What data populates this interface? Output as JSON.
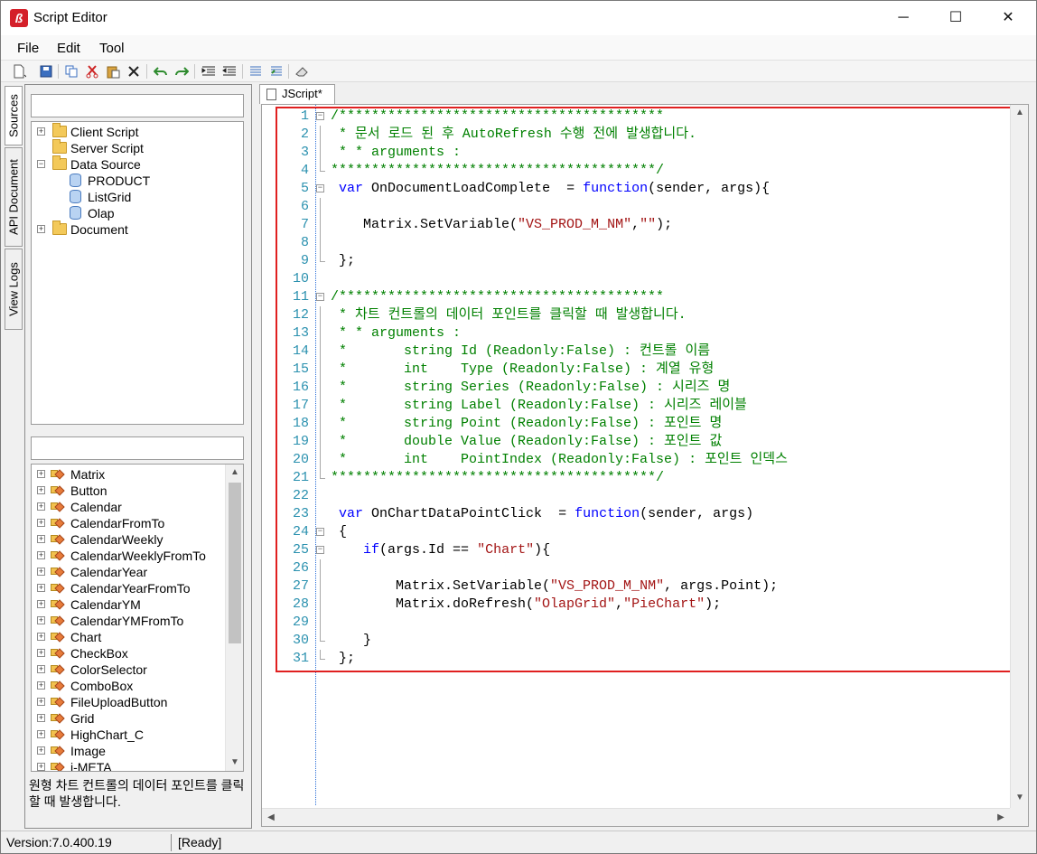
{
  "window": {
    "title": "Script Editor",
    "controls": {
      "minimize": "─",
      "maximize": "☐",
      "close": "✕"
    }
  },
  "menu": [
    "File",
    "Edit",
    "Tool"
  ],
  "toolbar_icons": [
    "new-file-icon",
    "save-icon",
    "copy-icon",
    "cut-icon",
    "paste-icon",
    "delete-icon",
    "undo-icon",
    "redo-icon",
    "indent-icon",
    "outdent-icon",
    "comment-icon",
    "uncomment-icon",
    "eraser-icon"
  ],
  "side_tabs": [
    "Sources",
    "API Document",
    "View Logs"
  ],
  "sources_filter": {
    "value": ""
  },
  "source_tree": [
    {
      "label": "Client Script",
      "type": "folder",
      "expander": "+",
      "level": 0
    },
    {
      "label": "Server Script",
      "type": "folder",
      "expander": "",
      "level": 0
    },
    {
      "label": "Data Source",
      "type": "folder",
      "expander": "−",
      "level": 0
    },
    {
      "label": "PRODUCT",
      "type": "datasource",
      "expander": "",
      "level": 1
    },
    {
      "label": "ListGrid",
      "type": "datasource",
      "expander": "",
      "level": 1
    },
    {
      "label": "Olap",
      "type": "datasource",
      "expander": "",
      "level": 1
    },
    {
      "label": "Document",
      "type": "folder",
      "expander": "+",
      "level": 0
    }
  ],
  "controls_filter": {
    "value": ""
  },
  "control_list": [
    "Matrix",
    "Button",
    "Calendar",
    "CalendarFromTo",
    "CalendarWeekly",
    "CalendarWeeklyFromTo",
    "CalendarYear",
    "CalendarYearFromTo",
    "CalendarYM",
    "CalendarYMFromTo",
    "Chart",
    "CheckBox",
    "ColorSelector",
    "ComboBox",
    "FileUploadButton",
    "Grid",
    "HighChart_C",
    "Image",
    "i-META"
  ],
  "description": "원형 차트 컨트롤의 데이터 포인트를 클릭할 때 발생합니다.",
  "editor": {
    "tab_label": "JScript*",
    "lines": [
      {
        "n": "1",
        "fold": "box",
        "tokens": [
          [
            "c",
            "/****************************************"
          ]
        ]
      },
      {
        "n": "2",
        "fold": "line",
        "tokens": [
          [
            "c",
            " * 문서 로드 된 후 AutoRefresh 수행 전에 발생합니다."
          ]
        ]
      },
      {
        "n": "3",
        "fold": "line",
        "tokens": [
          [
            "c",
            " * * arguments :"
          ]
        ]
      },
      {
        "n": "4",
        "fold": "end",
        "tokens": [
          [
            "c",
            "****************************************/"
          ]
        ]
      },
      {
        "n": "5",
        "fold": "box",
        "tokens": [
          [
            "p",
            " "
          ],
          [
            "k",
            "var"
          ],
          [
            "p",
            " OnDocumentLoadComplete  = "
          ],
          [
            "k",
            "function"
          ],
          [
            "p",
            "(sender, args){"
          ]
        ]
      },
      {
        "n": "6",
        "fold": "line",
        "tokens": []
      },
      {
        "n": "7",
        "fold": "line",
        "tokens": [
          [
            "p",
            "    Matrix.SetVariable("
          ],
          [
            "s",
            "\"VS_PROD_M_NM\""
          ],
          [
            "p",
            ","
          ],
          [
            "s",
            "\"\""
          ],
          [
            "p",
            ");"
          ]
        ]
      },
      {
        "n": "8",
        "fold": "line",
        "tokens": []
      },
      {
        "n": "9",
        "fold": "end",
        "tokens": [
          [
            "p",
            " };"
          ]
        ]
      },
      {
        "n": "10",
        "fold": "",
        "tokens": []
      },
      {
        "n": "11",
        "fold": "box",
        "tokens": [
          [
            "c",
            "/****************************************"
          ]
        ]
      },
      {
        "n": "12",
        "fold": "line",
        "tokens": [
          [
            "c",
            " * 차트 컨트롤의 데이터 포인트를 클릭할 때 발생합니다."
          ]
        ]
      },
      {
        "n": "13",
        "fold": "line",
        "tokens": [
          [
            "c",
            " * * arguments :"
          ]
        ]
      },
      {
        "n": "14",
        "fold": "line",
        "tokens": [
          [
            "c",
            " *       string Id (Readonly:False) : 컨트롤 이름"
          ]
        ]
      },
      {
        "n": "15",
        "fold": "line",
        "tokens": [
          [
            "c",
            " *       int    Type (Readonly:False) : 계열 유형"
          ]
        ]
      },
      {
        "n": "16",
        "fold": "line",
        "tokens": [
          [
            "c",
            " *       string Series (Readonly:False) : 시리즈 명"
          ]
        ]
      },
      {
        "n": "17",
        "fold": "line",
        "tokens": [
          [
            "c",
            " *       string Label (Readonly:False) : 시리즈 레이블"
          ]
        ]
      },
      {
        "n": "18",
        "fold": "line",
        "tokens": [
          [
            "c",
            " *       string Point (Readonly:False) : 포인트 명"
          ]
        ]
      },
      {
        "n": "19",
        "fold": "line",
        "tokens": [
          [
            "c",
            " *       double Value (Readonly:False) : 포인트 값"
          ]
        ]
      },
      {
        "n": "20",
        "fold": "line",
        "tokens": [
          [
            "c",
            " *       int    PointIndex (Readonly:False) : 포인트 인덱스"
          ]
        ]
      },
      {
        "n": "21",
        "fold": "end",
        "tokens": [
          [
            "c",
            "****************************************/"
          ]
        ]
      },
      {
        "n": "22",
        "fold": "",
        "tokens": []
      },
      {
        "n": "23",
        "fold": "",
        "tokens": [
          [
            "p",
            " "
          ],
          [
            "k",
            "var"
          ],
          [
            "p",
            " OnChartDataPointClick  = "
          ],
          [
            "k",
            "function"
          ],
          [
            "p",
            "(sender, args)"
          ]
        ]
      },
      {
        "n": "24",
        "fold": "box",
        "tokens": [
          [
            "p",
            " {"
          ]
        ]
      },
      {
        "n": "25",
        "fold": "box",
        "tokens": [
          [
            "p",
            "    "
          ],
          [
            "k",
            "if"
          ],
          [
            "p",
            "(args.Id == "
          ],
          [
            "s",
            "\"Chart\""
          ],
          [
            "p",
            "){"
          ]
        ]
      },
      {
        "n": "26",
        "fold": "line",
        "tokens": []
      },
      {
        "n": "27",
        "fold": "line",
        "tokens": [
          [
            "p",
            "        Matrix.SetVariable("
          ],
          [
            "s",
            "\"VS_PROD_M_NM\""
          ],
          [
            "p",
            ", args.Point);"
          ]
        ]
      },
      {
        "n": "28",
        "fold": "line",
        "tokens": [
          [
            "p",
            "        Matrix.doRefresh("
          ],
          [
            "s",
            "\"OlapGrid\""
          ],
          [
            "p",
            ","
          ],
          [
            "s",
            "\"PieChart\""
          ],
          [
            "p",
            ");"
          ]
        ]
      },
      {
        "n": "29",
        "fold": "line",
        "tokens": []
      },
      {
        "n": "30",
        "fold": "end",
        "tokens": [
          [
            "p",
            "    }"
          ]
        ]
      },
      {
        "n": "31",
        "fold": "end",
        "tokens": [
          [
            "p",
            " };"
          ]
        ]
      }
    ]
  },
  "status": {
    "version": "Version:7.0.400.19",
    "state": "[Ready]"
  },
  "colors": {
    "comment": "#008000",
    "keyword": "#0000ff",
    "string": "#a31515",
    "line_number": "#2b91af",
    "highlight_border": "#e02020"
  }
}
